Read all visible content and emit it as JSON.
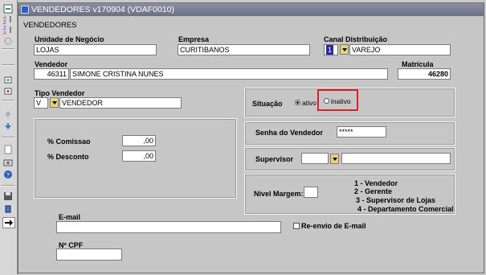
{
  "window": {
    "title": "VENDEDORES v170904 (VDAF0010)"
  },
  "section_title": "VENDEDORES",
  "unidade_negocio": {
    "label": "Unidade de Negócio",
    "value": "LOJAS"
  },
  "empresa": {
    "label": "Empresa",
    "value": "CURITIBANOS"
  },
  "canal_distribuicao": {
    "label": "Canal Distribuição",
    "code": "1",
    "value": "VAREJO"
  },
  "vendedor": {
    "label": "Vendedor",
    "code": "46311",
    "name": "SIMONE CRISTINA NUNES"
  },
  "matricula": {
    "label": "Matrícula",
    "value": "46280"
  },
  "tipo_vendedor": {
    "label": "Tipo Vendedor",
    "code": "V",
    "value": "VENDEDOR"
  },
  "situacao": {
    "label": "Situação",
    "options": [
      "ativo",
      "inativo"
    ],
    "selected": "ativo"
  },
  "comissao": {
    "label": "% Comissao",
    "value": ",00"
  },
  "desconto": {
    "label": "% Desconto",
    "value": ",00"
  },
  "senha": {
    "label": "Senha do Vendedor",
    "value": "*****"
  },
  "supervisor": {
    "label": "Supervisor",
    "code": "",
    "value": ""
  },
  "nivel_margem": {
    "label": "Nível Margem:",
    "value": "",
    "legend": [
      "1 - Vendedor",
      "2 - Gerente",
      "3 - Supervisor de Lojas",
      "4 - Departamento Comercial"
    ]
  },
  "email": {
    "label": "E-mail",
    "value": "",
    "reenvio_label": "Re-envio de E-mail"
  },
  "cpf": {
    "label": "Nº CPF",
    "value": ""
  },
  "highlight_color": "#e02020",
  "toolbar": {
    "icons": [
      "save-icon",
      "sort-asc-icon",
      "sort-desc-icon",
      "refresh-icon",
      "insert-record-icon",
      "delete-record-icon",
      "up-arrow-icon",
      "down-arrow-icon",
      "document-icon",
      "camera-icon",
      "help-icon",
      "floppy-icon",
      "trash-icon",
      "exit-icon"
    ]
  }
}
